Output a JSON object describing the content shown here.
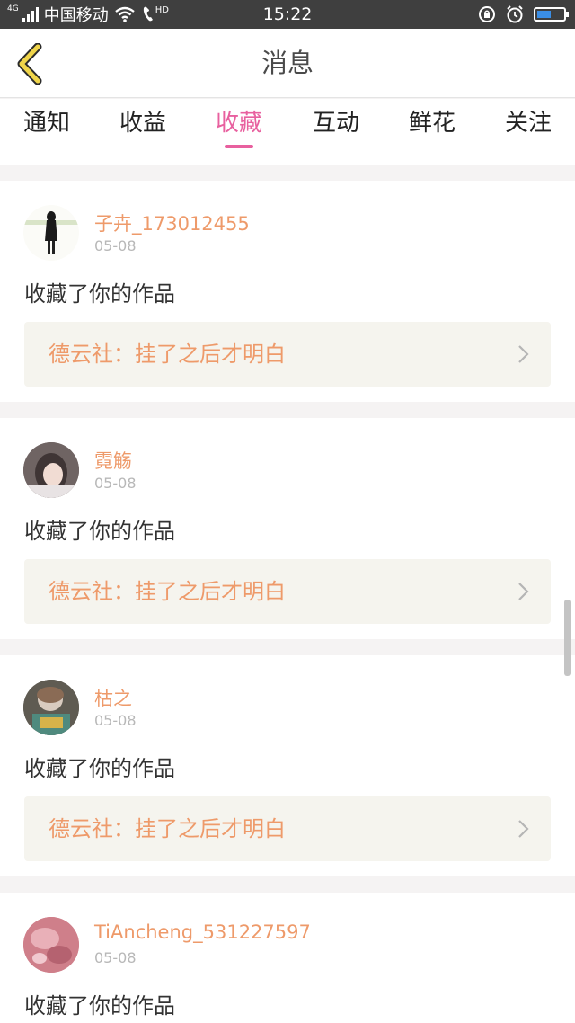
{
  "status_bar": {
    "network_type": "4G",
    "carrier": "中国移动",
    "hd_label": "HD",
    "time": "15:22",
    "battery_level": 0.55
  },
  "header": {
    "title": "消息"
  },
  "tabs": [
    {
      "label": "通知"
    },
    {
      "label": "收益"
    },
    {
      "label": "收藏",
      "active": true
    },
    {
      "label": "互动"
    },
    {
      "label": "鲜花"
    },
    {
      "label": "关注"
    }
  ],
  "colors": {
    "accent": "#e8609f",
    "name_orange": "#ee9a6a",
    "back_arrow": "#f0d54a"
  },
  "messages": [
    {
      "user": "子卉_173012455",
      "date": "05-08",
      "action": "收藏了你的作品",
      "work": "德云社：挂了之后才明白"
    },
    {
      "user": "霓觞",
      "date": "05-08",
      "action": "收藏了你的作品",
      "work": "德云社：挂了之后才明白"
    },
    {
      "user": "枯之",
      "date": "05-08",
      "action": "收藏了你的作品",
      "work": "德云社：挂了之后才明白"
    },
    {
      "user": "TiAncheng_531227597",
      "date": "05-08",
      "action": "收藏了你的作品",
      "work": ""
    }
  ]
}
